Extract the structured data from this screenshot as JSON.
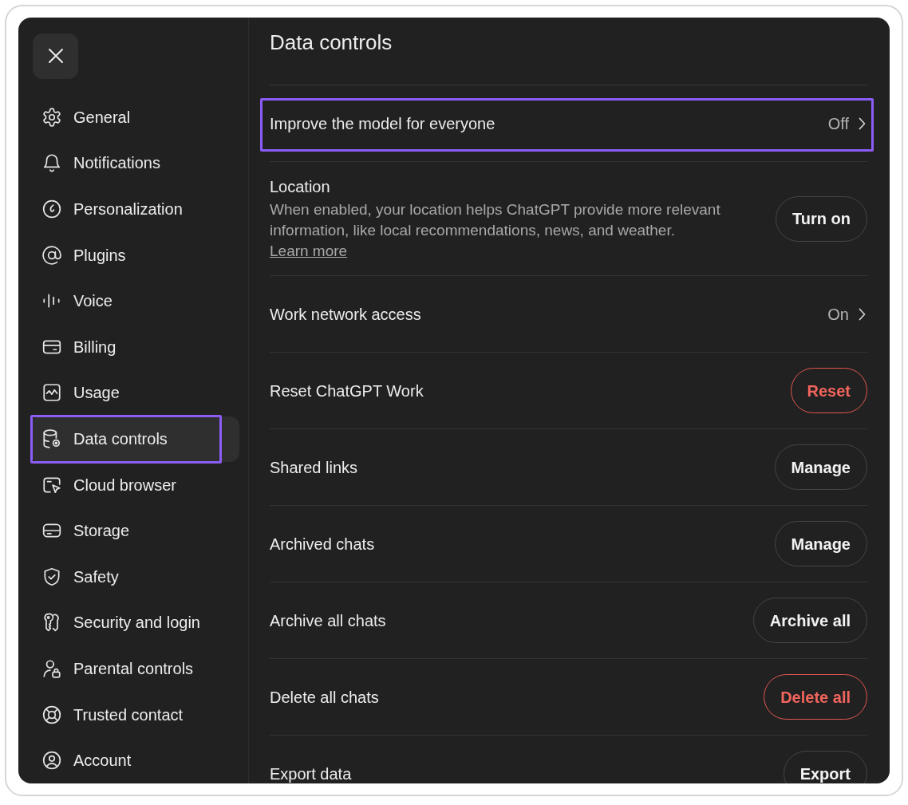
{
  "sidebar": {
    "items": [
      {
        "label": "General",
        "selected": false,
        "highlighted": false
      },
      {
        "label": "Notifications",
        "selected": false,
        "highlighted": false
      },
      {
        "label": "Personalization",
        "selected": false,
        "highlighted": false
      },
      {
        "label": "Plugins",
        "selected": false,
        "highlighted": false
      },
      {
        "label": "Voice",
        "selected": false,
        "highlighted": false
      },
      {
        "label": "Billing",
        "selected": false,
        "highlighted": false
      },
      {
        "label": "Usage",
        "selected": false,
        "highlighted": false
      },
      {
        "label": "Data controls",
        "selected": true,
        "highlighted": true
      },
      {
        "label": "Cloud browser",
        "selected": false,
        "highlighted": false
      },
      {
        "label": "Storage",
        "selected": false,
        "highlighted": false
      },
      {
        "label": "Safety",
        "selected": false,
        "highlighted": false
      },
      {
        "label": "Security and login",
        "selected": false,
        "highlighted": false
      },
      {
        "label": "Parental controls",
        "selected": false,
        "highlighted": false
      },
      {
        "label": "Trusted contact",
        "selected": false,
        "highlighted": false
      },
      {
        "label": "Account",
        "selected": false,
        "highlighted": false
      }
    ]
  },
  "settings": {
    "title": "Data controls",
    "rows": [
      {
        "kind": "link",
        "label": "Improve the model for everyone",
        "value": "Off",
        "highlighted": true
      },
      {
        "kind": "button",
        "label": "Location",
        "description": "When enabled, your location helps ChatGPT provide more relevant information, like local recommendations, news, and weather.",
        "link": "Learn more",
        "button": "Turn on",
        "destructive": false,
        "highlighted": false
      },
      {
        "kind": "link",
        "label": "Work network access",
        "value": "On",
        "highlighted": false
      },
      {
        "kind": "button",
        "label": "Reset ChatGPT Work",
        "button": "Reset",
        "destructive": true,
        "highlighted": false
      },
      {
        "kind": "button",
        "label": "Shared links",
        "button": "Manage",
        "destructive": false,
        "highlighted": false
      },
      {
        "kind": "button",
        "label": "Archived chats",
        "button": "Manage",
        "destructive": false,
        "highlighted": false
      },
      {
        "kind": "button",
        "label": "Archive all chats",
        "button": "Archive all",
        "destructive": false,
        "highlighted": false
      },
      {
        "kind": "button",
        "label": "Delete all chats",
        "button": "Delete all",
        "destructive": true,
        "highlighted": false
      },
      {
        "kind": "button",
        "label": "Export data",
        "button": "Export",
        "destructive": false,
        "highlighted": false
      }
    ]
  }
}
